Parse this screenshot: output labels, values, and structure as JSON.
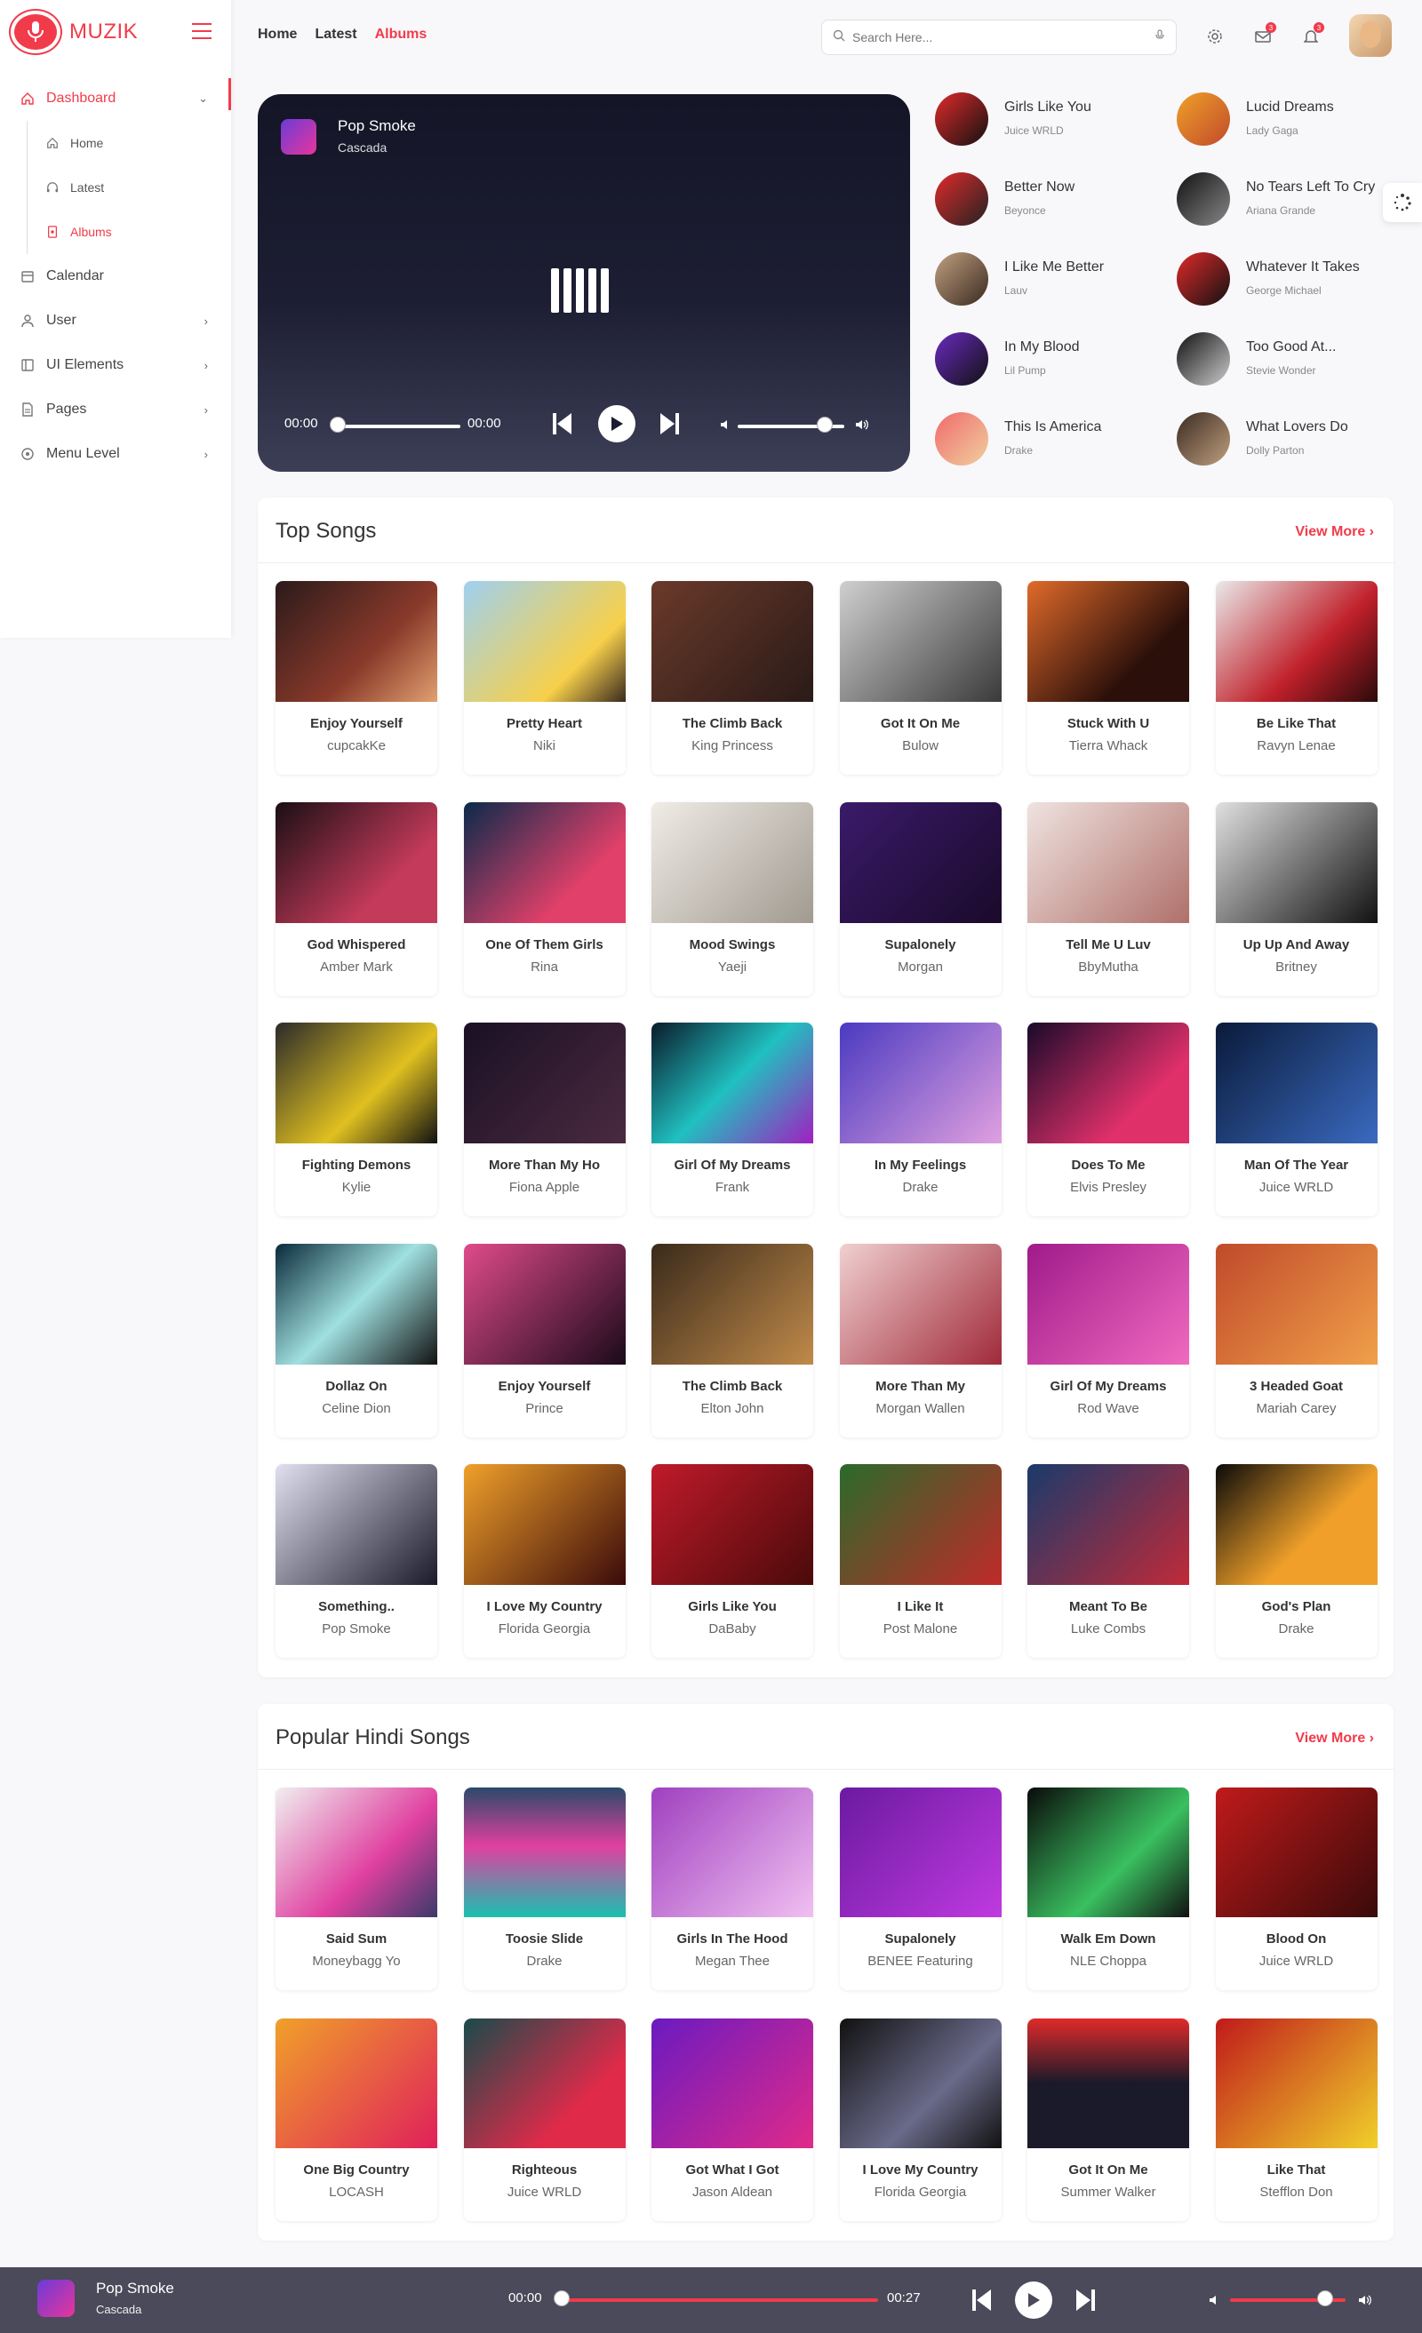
{
  "brand": {
    "name": "MUZIK"
  },
  "sidebar": {
    "items": [
      {
        "label": "Dashboard",
        "icon": "home-icon"
      },
      {
        "label": "Calendar",
        "icon": "calendar-icon"
      },
      {
        "label": "User",
        "icon": "user-icon"
      },
      {
        "label": "UI Elements",
        "icon": "layers-icon"
      },
      {
        "label": "Pages",
        "icon": "page-icon"
      },
      {
        "label": "Menu Level",
        "icon": "circle-icon"
      }
    ],
    "sub": [
      {
        "label": "Home"
      },
      {
        "label": "Latest"
      },
      {
        "label": "Albums"
      }
    ]
  },
  "topnav": {
    "home": "Home",
    "latest": "Latest",
    "albums": "Albums"
  },
  "search": {
    "placeholder": "Search Here..."
  },
  "header": {
    "notif_badge_1": "3",
    "notif_badge_2": "3"
  },
  "player": {
    "title": "Pop Smoke",
    "artist": "Cascada",
    "time_start": "00:00",
    "time_end": "00:00",
    "progress": 0,
    "volume": 0.82
  },
  "recent": [
    {
      "title": "Girls Like You",
      "artist": "Juice WRLD"
    },
    {
      "title": "Lucid Dreams",
      "artist": "Lady Gaga"
    },
    {
      "title": "Better Now",
      "artist": "Beyonce"
    },
    {
      "title": "No Tears Left To Cry",
      "artist": "Ariana Grande"
    },
    {
      "title": "I Like Me Better",
      "artist": "Lauv"
    },
    {
      "title": "Whatever It Takes",
      "artist": "George Michael"
    },
    {
      "title": "In My Blood",
      "artist": "Lil Pump"
    },
    {
      "title": "Too Good At...",
      "artist": "Stevie Wonder"
    },
    {
      "title": "This Is America",
      "artist": "Drake"
    },
    {
      "title": "What Lovers Do",
      "artist": "Dolly Parton"
    }
  ],
  "top_songs": {
    "title": "Top Songs",
    "view_more": "View More",
    "items": [
      {
        "title": "Enjoy Yourself",
        "artist": "cupcakKe"
      },
      {
        "title": "Pretty Heart",
        "artist": "Niki"
      },
      {
        "title": "The Climb Back",
        "artist": "King Princess"
      },
      {
        "title": "Got It On Me",
        "artist": "Bulow"
      },
      {
        "title": "Stuck With U",
        "artist": "Tierra Whack"
      },
      {
        "title": "Be Like That",
        "artist": "Ravyn Lenae"
      },
      {
        "title": "God Whispered",
        "artist": "Amber Mark"
      },
      {
        "title": "One Of Them Girls",
        "artist": "Rina"
      },
      {
        "title": "Mood Swings",
        "artist": "Yaeji"
      },
      {
        "title": "Supalonely",
        "artist": "Morgan"
      },
      {
        "title": "Tell Me U Luv",
        "artist": "BbyMutha"
      },
      {
        "title": "Up Up And Away",
        "artist": "Britney"
      },
      {
        "title": "Fighting Demons",
        "artist": "Kylie"
      },
      {
        "title": "More Than My Ho",
        "artist": "Fiona Apple"
      },
      {
        "title": "Girl Of My Dreams",
        "artist": "Frank"
      },
      {
        "title": "In My Feelings",
        "artist": "Drake"
      },
      {
        "title": "Does To Me",
        "artist": "Elvis Presley"
      },
      {
        "title": "Man Of The Year",
        "artist": "Juice WRLD"
      },
      {
        "title": "Dollaz On",
        "artist": "Celine Dion"
      },
      {
        "title": "Enjoy Yourself",
        "artist": "Prince"
      },
      {
        "title": "The Climb Back",
        "artist": "Elton John"
      },
      {
        "title": "More Than My",
        "artist": "Morgan Wallen"
      },
      {
        "title": "Girl Of My Dreams",
        "artist": "Rod Wave"
      },
      {
        "title": "3 Headed Goat",
        "artist": "Mariah Carey"
      },
      {
        "title": "Something..",
        "artist": "Pop Smoke"
      },
      {
        "title": "I Love My Country",
        "artist": "Florida Georgia"
      },
      {
        "title": "Girls Like You",
        "artist": "DaBaby"
      },
      {
        "title": "I Like It",
        "artist": "Post Malone"
      },
      {
        "title": "Meant To Be",
        "artist": "Luke Combs"
      },
      {
        "title": "God's Plan",
        "artist": "Drake"
      }
    ]
  },
  "hindi_songs": {
    "title": "Popular Hindi Songs",
    "view_more": "View More",
    "items": [
      {
        "title": "Said Sum",
        "artist": "Moneybagg Yo"
      },
      {
        "title": "Toosie Slide",
        "artist": "Drake"
      },
      {
        "title": "Girls In The Hood",
        "artist": "Megan Thee"
      },
      {
        "title": "Supalonely",
        "artist": "BENEE Featuring"
      },
      {
        "title": "Walk Em Down",
        "artist": "NLE Choppa"
      },
      {
        "title": "Blood On",
        "artist": "Juice WRLD"
      },
      {
        "title": "One Big Country",
        "artist": "LOCASH"
      },
      {
        "title": "Righteous",
        "artist": "Juice WRLD"
      },
      {
        "title": "Got What I Got",
        "artist": "Jason Aldean"
      },
      {
        "title": "I Love My Country",
        "artist": "Florida Georgia"
      },
      {
        "title": "Got It On Me",
        "artist": "Summer Walker"
      },
      {
        "title": "Like That",
        "artist": "Stefflon Don"
      }
    ]
  },
  "bottom_player": {
    "title": "Pop Smoke",
    "artist": "Cascada",
    "time_start": "00:00",
    "time_end": "00:27",
    "progress": 0,
    "volume": 0.82
  },
  "colors": {
    "accent": "#f23b4a"
  }
}
